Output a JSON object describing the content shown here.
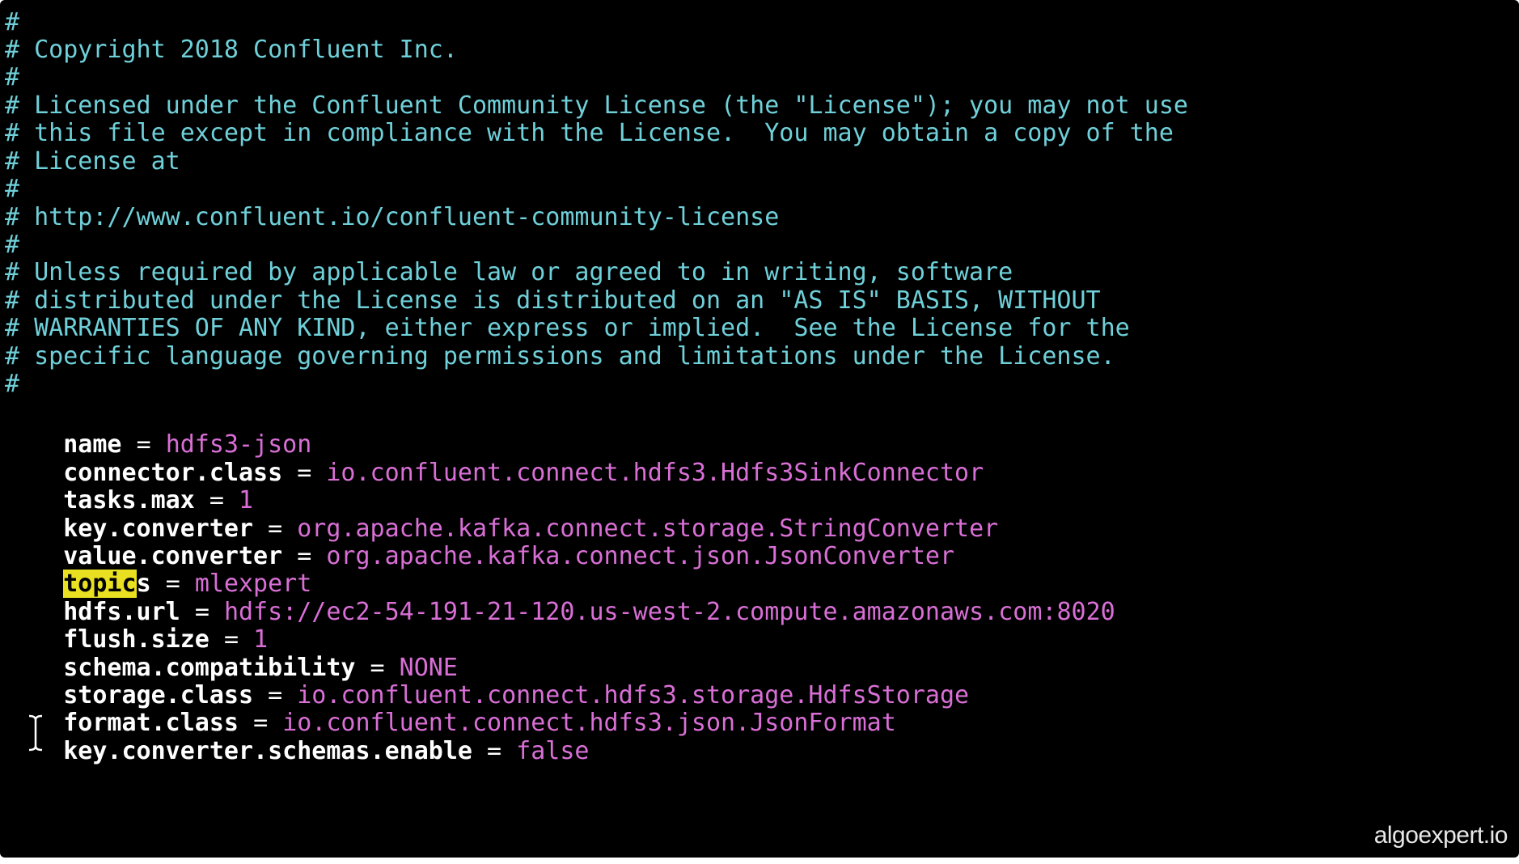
{
  "editor": {
    "comment_lines": [
      "#",
      "# Copyright 2018 Confluent Inc.",
      "#",
      "# Licensed under the Confluent Community License (the \"License\"); you may not use",
      "# this file except in compliance with the License.  You may obtain a copy of the",
      "# License at",
      "#",
      "# http://www.confluent.io/confluent-community-license",
      "#",
      "# Unless required by applicable law or agreed to in writing, software",
      "# distributed under the License is distributed on an \"AS IS\" BASIS, WITHOUT",
      "# WARRANTIES OF ANY KIND, either express or implied.  See the License for the",
      "# specific language governing permissions and limitations under the License.",
      "#"
    ],
    "properties": [
      {
        "key": "name",
        "value": "hdfs3-json"
      },
      {
        "key": "connector.class",
        "value": "io.confluent.connect.hdfs3.Hdfs3SinkConnector"
      },
      {
        "key": "tasks.max",
        "value": "1"
      },
      {
        "key": "key.converter",
        "value": "org.apache.kafka.connect.storage.StringConverter"
      },
      {
        "key": "value.converter",
        "value": "org.apache.kafka.connect.json.JsonConverter"
      },
      {
        "key": "topics",
        "value": "mlexpert",
        "highlight": "topic",
        "rest": "s"
      },
      {
        "key": "hdfs.url",
        "value": "hdfs://ec2-54-191-21-120.us-west-2.compute.amazonaws.com:8020"
      },
      {
        "key": "flush.size",
        "value": "1"
      },
      {
        "key": "schema.compatibility",
        "value": "NONE"
      },
      {
        "key": "storage.class",
        "value": "io.confluent.connect.hdfs3.storage.HdfsStorage"
      },
      {
        "key": "format.class",
        "value": "io.confluent.connect.hdfs3.json.JsonFormat"
      },
      {
        "key": "key.converter.schemas.enable",
        "value": "false"
      }
    ],
    "equals_sign": "="
  },
  "watermark": "algoexpert.io",
  "colors": {
    "background": "#000000",
    "comment": "#6fd0d9",
    "key": "#ffffff",
    "value": "#d96fd6",
    "search_highlight": "#e8e020"
  },
  "icons": {
    "cursor": "text-cursor-icon"
  }
}
